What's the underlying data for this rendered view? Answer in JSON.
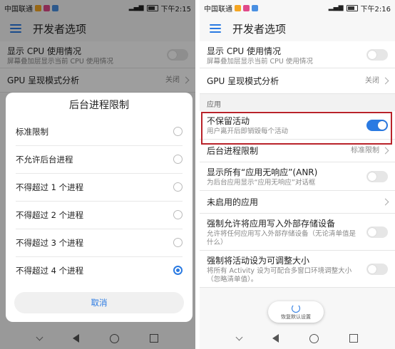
{
  "left": {
    "status": {
      "carrier": "中国联通",
      "time": "下午2:15"
    },
    "app_title": "开发者选项",
    "rows": [
      {
        "title": "显示 CPU 使用情况",
        "subtitle": "屏幕叠加层显示当前 CPU 使用情况"
      },
      {
        "title": "GPU 呈现模式分析",
        "value": "关闭"
      }
    ],
    "dialog": {
      "title": "后台进程限制",
      "options": [
        "标准限制",
        "不允许后台进程",
        "不得超过 1 个进程",
        "不得超过 2 个进程",
        "不得超过 3 个进程",
        "不得超过 4 个进程"
      ],
      "selected_index": 5,
      "cancel": "取消"
    }
  },
  "right": {
    "status": {
      "carrier": "中国联通",
      "time": "下午2:16"
    },
    "app_title": "开发者选项",
    "rows_top": [
      {
        "title": "显示 CPU 使用情况",
        "subtitle": "屏幕叠加层显示当前 CPU 使用情况"
      },
      {
        "title": "GPU 呈现模式分析",
        "value": "关闭"
      }
    ],
    "section": "应用",
    "rows": [
      {
        "title": "不保留活动",
        "subtitle": "用户离开后即销毁每个活动",
        "toggle_on": true
      },
      {
        "title": "后台进程限制",
        "value": "标准限制"
      },
      {
        "title": "显示所有“应用无响应”(ANR)",
        "subtitle": "为后台应用显示“应用无响应”对话框",
        "toggle_on": false
      },
      {
        "title": "未启用的应用"
      },
      {
        "title": "强制允许将应用写入外部存储设备",
        "subtitle": "允许将任何应用写入外部存储设备（无论清单值是什么）",
        "toggle_on": false
      },
      {
        "title": "强制将活动设为可调整大小",
        "subtitle": "将所有 Activity 设为可配合多窗口环境调整大小（忽略清单值）。",
        "toggle_on": false
      }
    ],
    "restore_label": "恢复默认设置"
  },
  "colors": {
    "accent": "#2a7ae2",
    "highlight": "#b9232a"
  }
}
